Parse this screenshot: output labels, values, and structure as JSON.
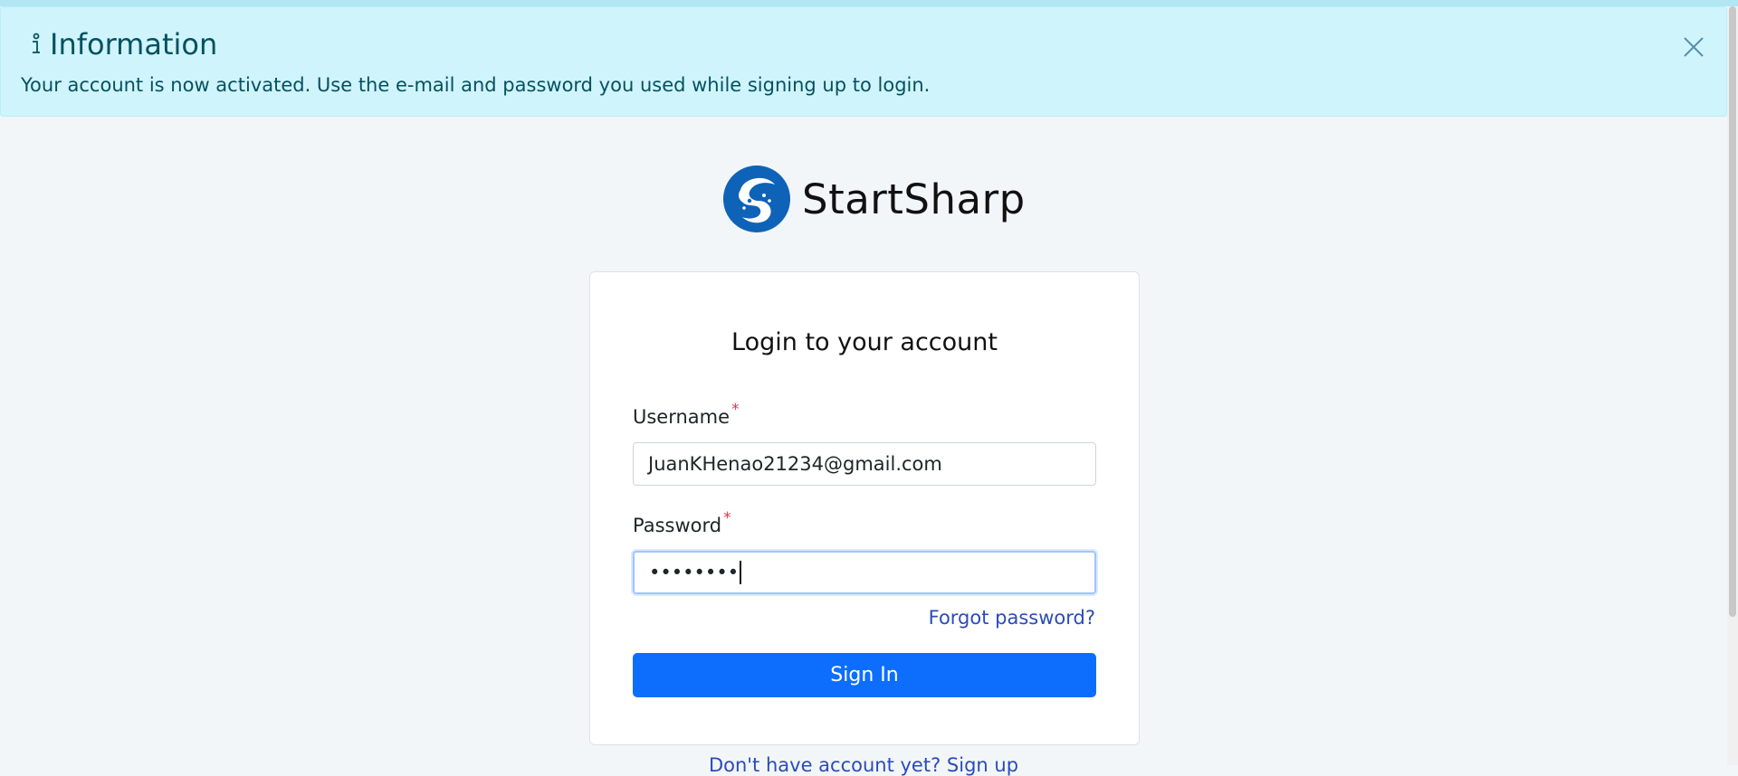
{
  "banner": {
    "title": "Information",
    "message": "Your account is now activated. Use the e-mail and password you used while signing up to login.",
    "colors": {
      "background": "#cff4fc",
      "text": "#055160"
    }
  },
  "brand": {
    "name": "StartSharp",
    "logo_icon": "startsharp-logo-icon"
  },
  "login": {
    "title": "Login to your account",
    "username_label": "Username",
    "username_value": "JuanKHenao21234@gmail.com",
    "password_label": "Password",
    "password_value": "••••••••",
    "required_marker": "*",
    "forgot_label": "Forgot password?",
    "signin_label": "Sign In"
  },
  "signup": {
    "label": "Don't have account yet? Sign up"
  },
  "colors": {
    "primary": "#0d6efd",
    "link": "#2b4bb8",
    "required": "#dc3545"
  }
}
